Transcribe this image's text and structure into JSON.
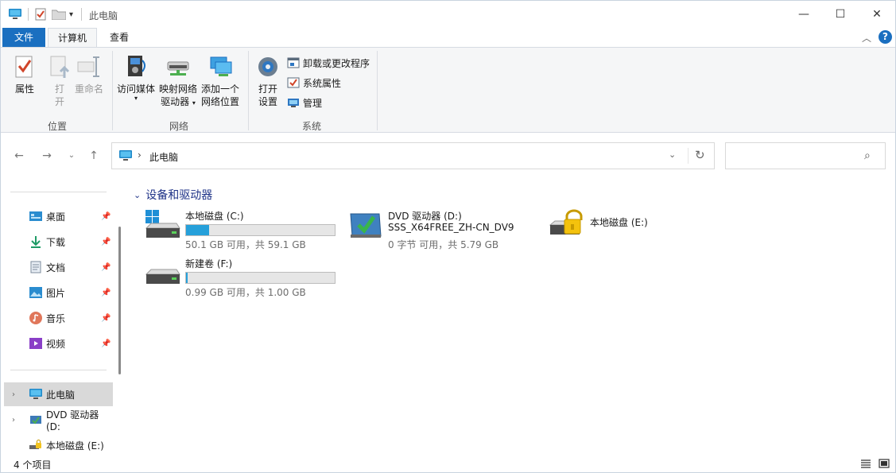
{
  "titlebar": {
    "title": "此电脑",
    "minimize": "—",
    "maximize": "☐",
    "close": "✕"
  },
  "tabs": {
    "file": "文件",
    "computer": "计算机",
    "view": "查看"
  },
  "ribbon": {
    "location": {
      "label": "位置",
      "properties": "属性",
      "open_l1": "打",
      "open_l2": "开",
      "rename": "重命名"
    },
    "network": {
      "label": "网络",
      "media_l1": "访问媒体",
      "map_l1": "映射网络",
      "map_l2": "驱动器",
      "add_l1": "添加一个",
      "add_l2": "网络位置"
    },
    "system": {
      "label": "系统",
      "settings_l1": "打开",
      "settings_l2": "设置",
      "uninstall": "卸载或更改程序",
      "sys_props": "系统属性",
      "manage": "管理"
    }
  },
  "address": {
    "crumb": "此电脑"
  },
  "search": {
    "placeholder": ""
  },
  "sidebar": {
    "quick": [
      {
        "label": "桌面"
      },
      {
        "label": "下载"
      },
      {
        "label": "文档"
      },
      {
        "label": "图片"
      },
      {
        "label": "音乐"
      },
      {
        "label": "视频"
      }
    ],
    "tree": [
      {
        "label": "此电脑"
      },
      {
        "label": "DVD 驱动器 (D:"
      },
      {
        "label": "本地磁盘 (E:)"
      }
    ]
  },
  "content": {
    "section_title": "设备和驱动器",
    "drives": [
      {
        "name": "本地磁盘 (C:)",
        "free_text": "50.1 GB 可用，共 59.1 GB",
        "used_fraction": 0.153
      },
      {
        "name": "DVD 驱动器 (D:)",
        "subtitle": "SSS_X64FREE_ZH-CN_DV9",
        "free_text": "0 字节 可用，共 5.79 GB"
      },
      {
        "name": "本地磁盘 (E:)"
      },
      {
        "name": "新建卷 (F:)",
        "free_text": "0.99 GB 可用，共 1.00 GB",
        "used_fraction": 0.01
      }
    ]
  },
  "statusbar": {
    "count": "4 个项目"
  },
  "colors": {
    "accent": "#1a6fc0",
    "bar_fill": "#26a0da",
    "section_title": "#1e3287"
  }
}
